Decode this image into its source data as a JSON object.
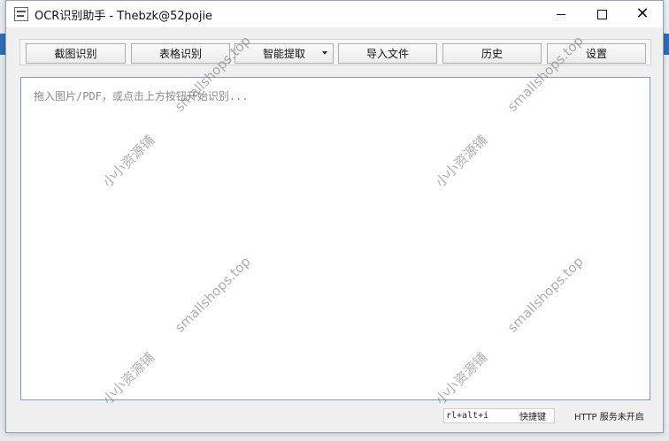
{
  "window": {
    "title": "OCR识别助手 - Thebzk@52pojie",
    "minimize": "—",
    "maximize": "☐",
    "close": "✕"
  },
  "toolbar": {
    "buttons": [
      {
        "label": "截图识别"
      },
      {
        "label": "表格识别"
      },
      {
        "label": "智能提取"
      },
      {
        "label": "导入文件"
      },
      {
        "label": "历史"
      },
      {
        "label": "设置"
      }
    ]
  },
  "editor": {
    "placeholder": "拖入图片/PDF，或点击上方按钮开始识别..."
  },
  "status": {
    "hotkey_value": "rl+alt+i",
    "hotkey_label": "快捷键",
    "http_status": "HTTP 服务未开启"
  },
  "watermarks": {
    "cn": "小小资源铺",
    "en": "smallshops.top"
  },
  "colors": {
    "editor_border": "#7a9ccc",
    "window_bg": "#f0f0f0",
    "watermark": "#6e6e6e"
  },
  "icons": {
    "app": "ocr-app-icon",
    "dropdown": "caret-down-icon"
  }
}
